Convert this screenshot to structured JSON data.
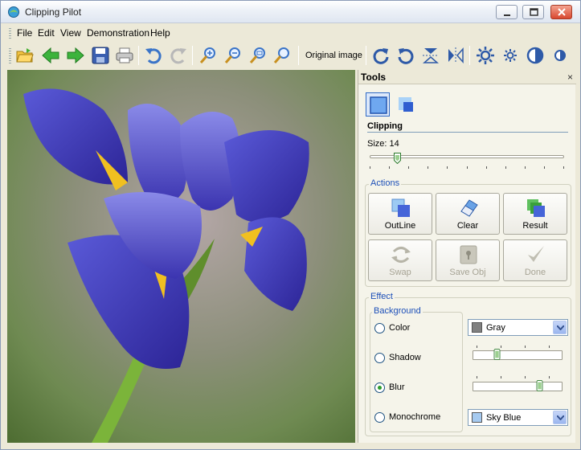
{
  "window": {
    "title": "Clipping Pilot"
  },
  "menu": [
    "File",
    "Edit",
    "View",
    "Demonstration",
    "Help"
  ],
  "toolbar": {
    "original_image_label": "Original image"
  },
  "panel": {
    "title": "Tools",
    "close_glyph": "×",
    "clipping_label": "Clipping",
    "size_label": "Size: 14",
    "size_value": 14,
    "actions_legend": "Actions",
    "actions": [
      {
        "label": "OutLine",
        "enabled": true
      },
      {
        "label": "Clear",
        "enabled": true
      },
      {
        "label": "Result",
        "enabled": true
      },
      {
        "label": "Swap",
        "enabled": false
      },
      {
        "label": "Save Obj",
        "enabled": false
      },
      {
        "label": "Done",
        "enabled": false
      }
    ],
    "effect_legend": "Effect",
    "background_legend": "Background",
    "options": [
      {
        "label": "Color",
        "selected": false
      },
      {
        "label": "Shadow",
        "selected": false
      },
      {
        "label": "Blur",
        "selected": true
      },
      {
        "label": "Monochrome",
        "selected": false
      }
    ],
    "color_combo": {
      "value": "Gray",
      "swatch": "#808080"
    },
    "mono_combo": {
      "value": "Sky Blue",
      "swatch": "#a6caf0"
    }
  },
  "colors": {
    "accent": "#316ac5",
    "legend": "#1c4fb8",
    "panel_bg": "#f5f4ea"
  }
}
